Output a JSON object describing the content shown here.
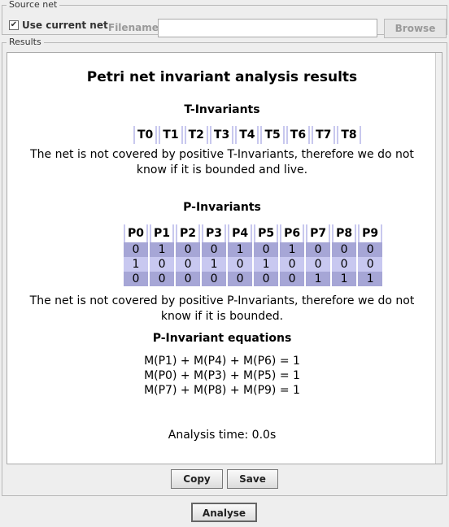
{
  "source_net": {
    "legend": "Source net",
    "use_current_label": "Use current net",
    "use_current_checked": true,
    "filename_label": "Filename:",
    "filename_value": "",
    "browse_label": "Browse"
  },
  "results": {
    "legend": "Results",
    "title": "Petri net invariant analysis results",
    "t_heading": "T-Invariants",
    "t_columns": [
      "T0",
      "T1",
      "T2",
      "T3",
      "T4",
      "T5",
      "T6",
      "T7",
      "T8"
    ],
    "t_note": "The net is not covered by positive T-Invariants, therefore we do not know if it is bounded and live.",
    "p_heading": "P-Invariants",
    "p_columns": [
      "P0",
      "P1",
      "P2",
      "P3",
      "P4",
      "P5",
      "P6",
      "P7",
      "P8",
      "P9"
    ],
    "p_rows": [
      [
        "0",
        "1",
        "0",
        "0",
        "1",
        "0",
        "1",
        "0",
        "0",
        "0"
      ],
      [
        "1",
        "0",
        "0",
        "1",
        "0",
        "1",
        "0",
        "0",
        "0",
        "0"
      ],
      [
        "0",
        "0",
        "0",
        "0",
        "0",
        "0",
        "0",
        "1",
        "1",
        "1"
      ]
    ],
    "p_note": "The net is not covered by positive P-Invariants, therefore we do not know if it is bounded.",
    "eq_heading": "P-Invariant equations",
    "equations": [
      "M(P1) + M(P4) + M(P6) = 1",
      "M(P0) + M(P3) + M(P5) = 1",
      "M(P7) + M(P8) + M(P9) = 1"
    ],
    "analysis_time": "Analysis time: 0.0s"
  },
  "buttons": {
    "copy": "Copy",
    "save": "Save",
    "analyse": "Analyse"
  }
}
